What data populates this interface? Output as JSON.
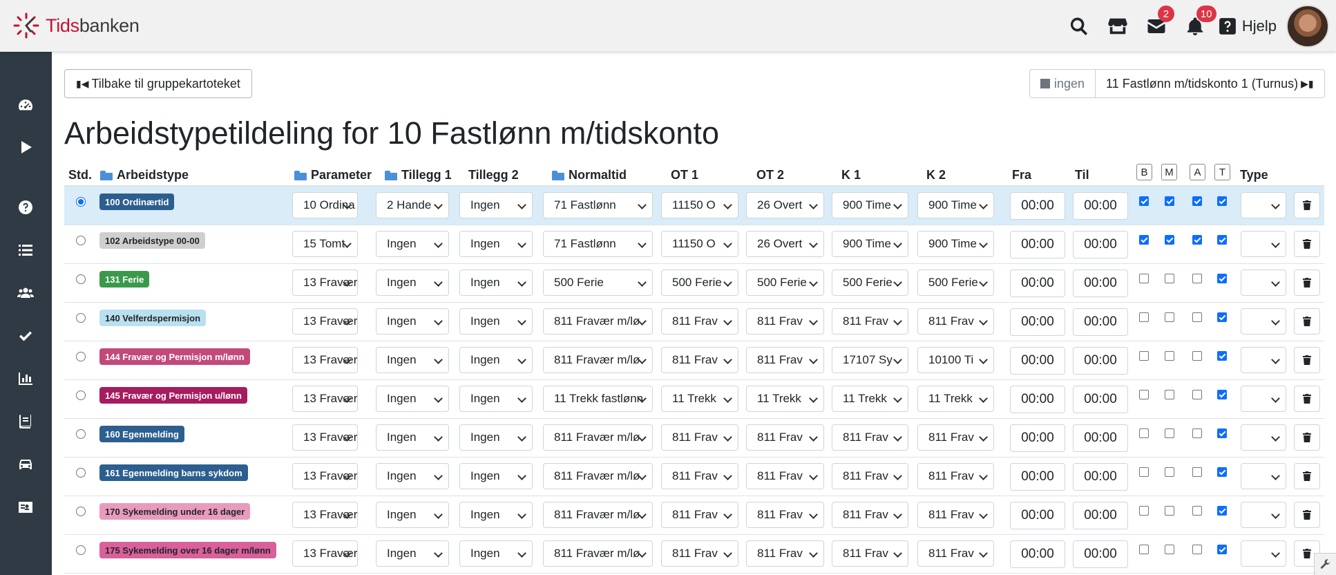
{
  "app": {
    "brand_red": "Tids",
    "brand_dark": "banken"
  },
  "header": {
    "help_label": "Hjelp",
    "icons": [
      {
        "name": "search-icon"
      },
      {
        "name": "store-icon"
      },
      {
        "name": "mail-icon",
        "badge": "2"
      },
      {
        "name": "bell-icon",
        "badge": "10"
      }
    ]
  },
  "sidebar": {
    "items": [
      "dashboard-icon",
      "play-icon",
      "help-icon",
      "list-icon",
      "users-icon",
      "check-icon",
      "chart-icon",
      "book-icon",
      "car-icon",
      "id-card-icon"
    ]
  },
  "nav": {
    "back_label": "Tilbake til gruppekartoteket",
    "prev_label": "ingen",
    "next_label": "11 Fastlønn m/tidskonto 1 (Turnus)"
  },
  "page_title": "Arbeidstypetildeling for 10 Fastlønn m/tidskonto",
  "table": {
    "headers": {
      "std": "Std.",
      "arbeidstype": "Arbeidstype",
      "parameter": "Parameter",
      "tillegg1": "Tillegg 1",
      "tillegg2": "Tillegg 2",
      "normaltid": "Normaltid",
      "ot1": "OT 1",
      "ot2": "OT 2",
      "k1": "K 1",
      "k2": "K 2",
      "fra": "Fra",
      "til": "Til",
      "b": "B",
      "m": "M",
      "a": "A",
      "t": "T",
      "type": "Type"
    },
    "rows": [
      {
        "std": true,
        "tag": "100 Ordinærtid",
        "tag_bg": "#2c5f8f",
        "tag_fg": "#ffffff",
        "parameter": "10 Ordina",
        "tillegg1": "2 Hande",
        "tillegg2": "Ingen",
        "normaltid": "71 Fastlønn",
        "ot1": "11150 O",
        "ot2": "26 Overt",
        "k1": "900 Time",
        "k2": "900 Time",
        "fra": "00:00",
        "til": "00:00",
        "b": true,
        "m": true,
        "a": true,
        "t": true,
        "type": ""
      },
      {
        "std": false,
        "tag": "102 Arbeidstype 00-00",
        "tag_bg": "#cfcfcf",
        "tag_fg": "#212529",
        "parameter": "15 Tomt",
        "tillegg1": "Ingen",
        "tillegg2": "Ingen",
        "normaltid": "71 Fastlønn",
        "ot1": "11150 O",
        "ot2": "26 Overt",
        "k1": "900 Time",
        "k2": "900 Time",
        "fra": "00:00",
        "til": "00:00",
        "b": true,
        "m": true,
        "a": true,
        "t": true,
        "type": ""
      },
      {
        "std": false,
        "tag": "131 Ferie",
        "tag_bg": "#3a9a4a",
        "tag_fg": "#ffffff",
        "parameter": "13 Fravær",
        "tillegg1": "Ingen",
        "tillegg2": "Ingen",
        "normaltid": "500 Ferie",
        "ot1": "500 Ferie",
        "ot2": "500 Ferie",
        "k1": "500 Ferie",
        "k2": "500 Ferie",
        "fra": "00:00",
        "til": "00:00",
        "b": false,
        "m": false,
        "a": false,
        "t": true,
        "type": ""
      },
      {
        "std": false,
        "tag": "140 Velferdspermisjon",
        "tag_bg": "#b9e0ef",
        "tag_fg": "#212529",
        "parameter": "13 Fravær",
        "tillegg1": "Ingen",
        "tillegg2": "Ingen",
        "normaltid": "811 Fravær m/lø",
        "ot1": "811 Frav",
        "ot2": "811 Frav",
        "k1": "811 Frav",
        "k2": "811 Frav",
        "fra": "00:00",
        "til": "00:00",
        "b": false,
        "m": false,
        "a": false,
        "t": true,
        "type": ""
      },
      {
        "std": false,
        "tag": "144 Fravær og Permisjon m/lønn",
        "tag_bg": "#c2497a",
        "tag_fg": "#ffffff",
        "parameter": "13 Fravær",
        "tillegg1": "Ingen",
        "tillegg2": "Ingen",
        "normaltid": "811 Fravær m/lø",
        "ot1": "811 Frav",
        "ot2": "811 Frav",
        "k1": "17107 Sy",
        "k2": "10100 Ti",
        "fra": "00:00",
        "til": "00:00",
        "b": false,
        "m": false,
        "a": false,
        "t": true,
        "type": ""
      },
      {
        "std": false,
        "tag": "145 Fravær og Permisjon u/lønn",
        "tag_bg": "#a51d5e",
        "tag_fg": "#ffffff",
        "parameter": "13 Fravær",
        "tillegg1": "Ingen",
        "tillegg2": "Ingen",
        "normaltid": "11 Trekk fastlønn",
        "ot1": "11 Trekk",
        "ot2": "11 Trekk",
        "k1": "11 Trekk",
        "k2": "11 Trekk",
        "fra": "00:00",
        "til": "00:00",
        "b": false,
        "m": false,
        "a": false,
        "t": true,
        "type": ""
      },
      {
        "std": false,
        "tag": "160 Egenmelding",
        "tag_bg": "#2c5f8f",
        "tag_fg": "#ffffff",
        "parameter": "13 Fravær",
        "tillegg1": "Ingen",
        "tillegg2": "Ingen",
        "normaltid": "811 Fravær m/lø",
        "ot1": "811 Frav",
        "ot2": "811 Frav",
        "k1": "811 Frav",
        "k2": "811 Frav",
        "fra": "00:00",
        "til": "00:00",
        "b": false,
        "m": false,
        "a": false,
        "t": true,
        "type": ""
      },
      {
        "std": false,
        "tag": "161 Egenmelding barns sykdom",
        "tag_bg": "#2c5f8f",
        "tag_fg": "#ffffff",
        "parameter": "13 Fravær",
        "tillegg1": "Ingen",
        "tillegg2": "Ingen",
        "normaltid": "811 Fravær m/lø",
        "ot1": "811 Frav",
        "ot2": "811 Frav",
        "k1": "811 Frav",
        "k2": "811 Frav",
        "fra": "00:00",
        "til": "00:00",
        "b": false,
        "m": false,
        "a": false,
        "t": true,
        "type": ""
      },
      {
        "std": false,
        "tag": "170 Sykemelding under 16 dager",
        "tag_bg": "#e89bbd",
        "tag_fg": "#212529",
        "parameter": "13 Fravær",
        "tillegg1": "Ingen",
        "tillegg2": "Ingen",
        "normaltid": "811 Fravær m/lø",
        "ot1": "811 Frav",
        "ot2": "811 Frav",
        "k1": "811 Frav",
        "k2": "811 Frav",
        "fra": "00:00",
        "til": "00:00",
        "b": false,
        "m": false,
        "a": false,
        "t": true,
        "type": ""
      },
      {
        "std": false,
        "tag": "175 Sykemelding over 16 dager m/lønn",
        "tag_bg": "#d9609a",
        "tag_fg": "#212529",
        "parameter": "13 Fravær",
        "tillegg1": "Ingen",
        "tillegg2": "Ingen",
        "normaltid": "811 Fravær m/lø",
        "ot1": "811 Frav",
        "ot2": "811 Frav",
        "k1": "811 Frav",
        "k2": "811 Frav",
        "fra": "00:00",
        "til": "00:00",
        "b": false,
        "m": false,
        "a": false,
        "t": true,
        "type": ""
      }
    ]
  }
}
